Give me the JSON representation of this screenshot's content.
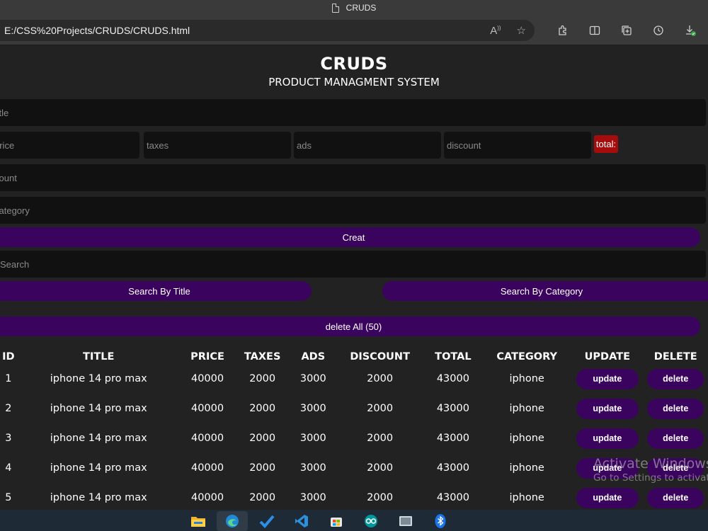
{
  "browser": {
    "tab_title": "CRUDS",
    "address": "E:/CSS%20Projects/CRUDS/CRUDS.html",
    "address_icons": [
      "read-aloud-icon",
      "favorite-star-icon"
    ],
    "toolbar_icons": [
      "extensions-icon",
      "split-screen-icon",
      "collections-icon",
      "history-icon",
      "downloads-icon"
    ]
  },
  "page": {
    "title": "CRUDS",
    "subtitle": "PRODUCT MANAGMENT SYSTEM",
    "inputs": {
      "title_placeholder": "title",
      "price_placeholder": "price",
      "taxes_placeholder": "taxes",
      "ads_placeholder": "ads",
      "discount_placeholder": "discount",
      "count_placeholder": "count",
      "category_placeholder": "category",
      "search_placeholder": "Search"
    },
    "total_label": "total:",
    "create_label": "Creat",
    "search_by_title_label": "Search By Title",
    "search_by_category_label": "Search By Category",
    "delete_all_label": "delete All (50)",
    "colors": {
      "button": "#3a045e",
      "total": "#a50d0d",
      "background": "#222222",
      "input": "#111111"
    }
  },
  "table": {
    "headers": [
      "ID",
      "TITLE",
      "PRICE",
      "TAXES",
      "ADS",
      "DISCOUNT",
      "TOTAL",
      "CATEGORY",
      "UPDATE",
      "DELETE"
    ],
    "update_label": "update",
    "delete_label": "delete",
    "rows": [
      {
        "id": "1",
        "title": "iphone 14 pro max",
        "price": "40000",
        "taxes": "2000",
        "ads": "3000",
        "discount": "2000",
        "total": "43000",
        "category": "iphone"
      },
      {
        "id": "2",
        "title": "iphone 14 pro max",
        "price": "40000",
        "taxes": "2000",
        "ads": "3000",
        "discount": "2000",
        "total": "43000",
        "category": "iphone"
      },
      {
        "id": "3",
        "title": "iphone 14 pro max",
        "price": "40000",
        "taxes": "2000",
        "ads": "3000",
        "discount": "2000",
        "total": "43000",
        "category": "iphone"
      },
      {
        "id": "4",
        "title": "iphone 14 pro max",
        "price": "40000",
        "taxes": "2000",
        "ads": "3000",
        "discount": "2000",
        "total": "43000",
        "category": "iphone"
      },
      {
        "id": "5",
        "title": "iphone 14 pro max",
        "price": "40000",
        "taxes": "2000",
        "ads": "3000",
        "discount": "2000",
        "total": "43000",
        "category": "iphone"
      }
    ]
  },
  "watermark": {
    "line1": "Activate Windows",
    "line2": "Go to Settings to activate Windows."
  },
  "taskbar": {
    "apps": [
      "file-explorer-icon",
      "edge-browser-icon",
      "todo-icon",
      "vscode-icon",
      "microsoft-store-icon",
      "arduino-icon",
      "screen-app-icon",
      "bluetooth-icon"
    ]
  }
}
